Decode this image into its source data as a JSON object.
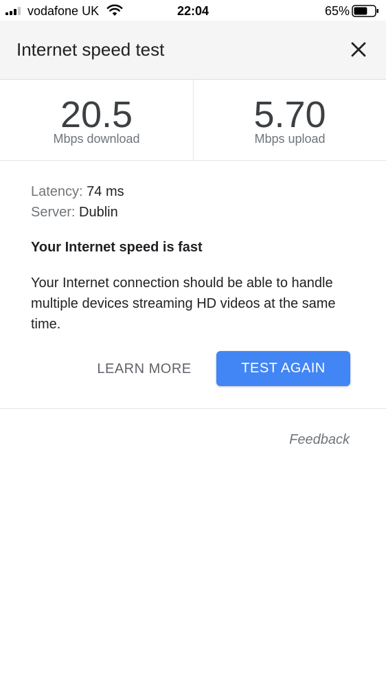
{
  "status_bar": {
    "carrier": "vodafone UK",
    "time": "22:04",
    "battery_percent": "65%",
    "battery_level": 0.65,
    "signal_icon": "cellular-signal-icon",
    "wifi_icon": "wifi-icon",
    "battery_icon": "battery-icon"
  },
  "header": {
    "title": "Internet speed test",
    "close_icon": "close-icon"
  },
  "results": {
    "download": {
      "value": "20.5",
      "unit": "Mbps download"
    },
    "upload": {
      "value": "5.70",
      "unit": "Mbps upload"
    }
  },
  "details": {
    "latency_label": "Latency:",
    "latency_value": "74 ms",
    "server_label": "Server:",
    "server_value": "Dublin"
  },
  "summary": {
    "headline": "Your Internet speed is fast",
    "description": "Your Internet connection should be able to handle multiple devices streaming HD videos at the same time."
  },
  "actions": {
    "learn_more": "LEARN MORE",
    "test_again": "TEST AGAIN"
  },
  "feedback": "Feedback",
  "colors": {
    "accent": "#4285f4",
    "header_bg": "#f5f5f5",
    "muted_text": "#70757a"
  }
}
